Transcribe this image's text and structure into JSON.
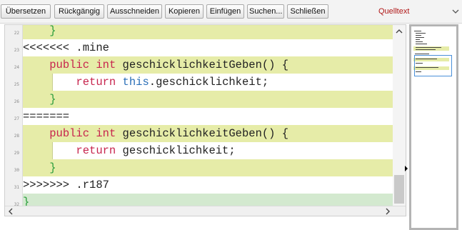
{
  "toolbar": {
    "buttons": [
      "Übersetzen",
      "Rückgängig",
      "Ausschneiden",
      "Kopieren",
      "Einfügen",
      "Suchen...",
      "Schließen"
    ],
    "language_selected": "Quelltext"
  },
  "editor": {
    "line_numbers": [
      "22",
      "23",
      "24",
      "25",
      "26",
      "27",
      "28",
      "29",
      "30",
      "31",
      "32"
    ],
    "lines": [
      {
        "indent": "    ",
        "brace": "}"
      },
      {
        "text": "<<<<<<< .mine"
      },
      {
        "indent": "    ",
        "kw1": "public",
        "sp1": " ",
        "kw2": "int",
        "rest": " geschicklichkeitGeben() {"
      },
      {
        "indent": "        ",
        "kw1": "return",
        "sp1": " ",
        "kw2": "this",
        "rest": ".geschicklichkeit;"
      },
      {
        "indent": "    ",
        "brace": "}"
      },
      {
        "text": "======="
      },
      {
        "indent": "    ",
        "kw1": "public",
        "sp1": " ",
        "kw2": "int",
        "rest": " geschicklichkeitGeben() {"
      },
      {
        "indent": "        ",
        "kw1": "return",
        "rest": " geschicklichkeit;"
      },
      {
        "indent": "    ",
        "brace": "}"
      },
      {
        "text": ">>>>>>> .r187"
      },
      {
        "brace": "}"
      }
    ]
  },
  "colors": {
    "changed_bg": "#e6eca8",
    "added_bg": "#d3e9cf",
    "keyword_red": "#c7254e",
    "keyword_blue": "#2b6fb8",
    "brace_green": "#2a9d3c",
    "language_red": "#b01818"
  },
  "icons": [
    "chevron-down-icon",
    "scroll-up-arrow-icon",
    "scroll-left-arrow-icon",
    "scroll-right-arrow-icon",
    "diff-marker-arrow-icon"
  ]
}
